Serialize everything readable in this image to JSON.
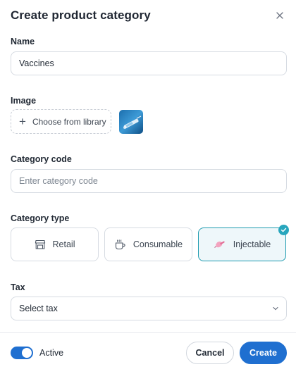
{
  "modal": {
    "title": "Create product category"
  },
  "form": {
    "name": {
      "label": "Name",
      "value": "Vaccines"
    },
    "image": {
      "label": "Image",
      "choose_label": "Choose from library"
    },
    "category_code": {
      "label": "Category code",
      "placeholder": "Enter category code"
    },
    "category_type": {
      "label": "Category type",
      "options": [
        {
          "label": "Retail",
          "icon": "store-icon"
        },
        {
          "label": "Consumable",
          "icon": "cup-icon"
        },
        {
          "label": "Injectable",
          "icon": "syringe-icon",
          "selected": true
        }
      ]
    },
    "tax": {
      "label": "Tax",
      "selected": "Select tax"
    }
  },
  "footer": {
    "active_label": "Active",
    "active": true,
    "cancel_label": "Cancel",
    "create_label": "Create"
  },
  "colors": {
    "primary": "#1f6fd0",
    "selected_border": "#1e9bb0",
    "selected_bg": "#eef7fa"
  }
}
